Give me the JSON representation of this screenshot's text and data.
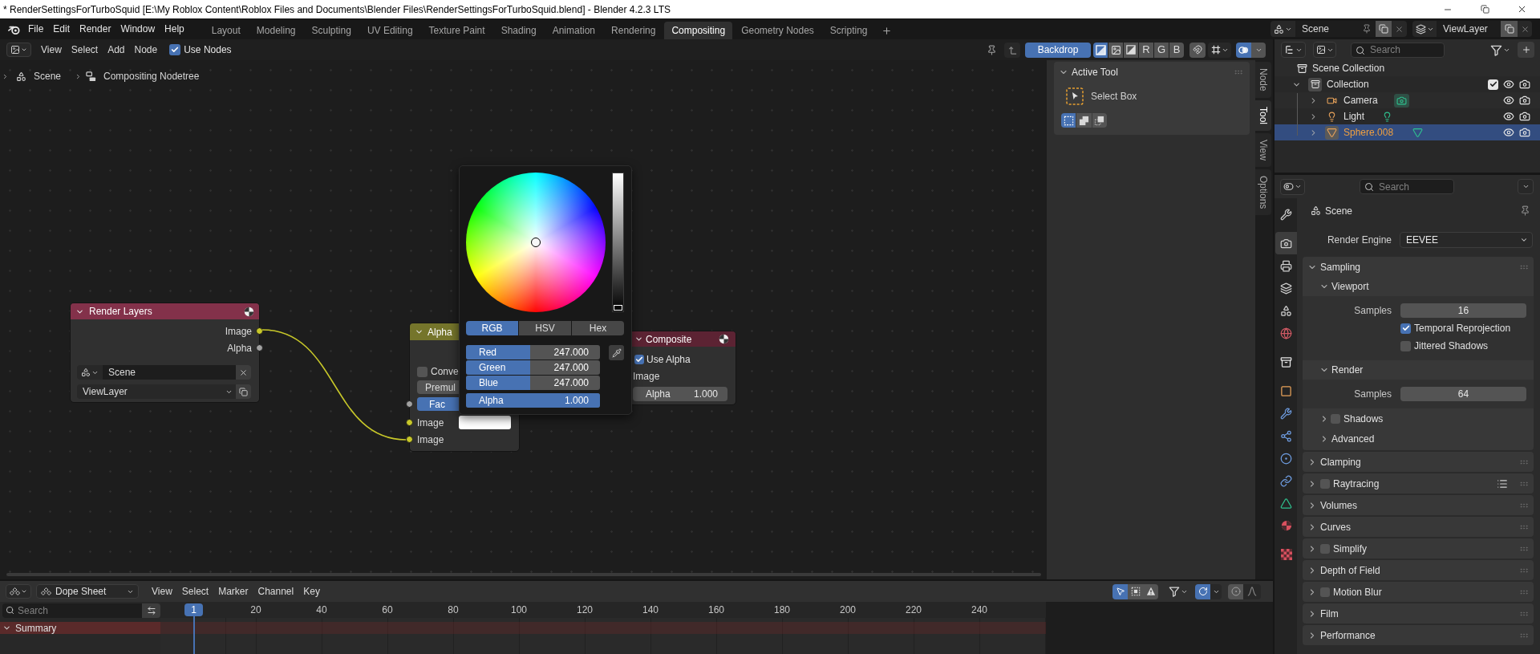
{
  "window": {
    "title": "* RenderSettingsForTurboSquid [E:\\My Roblox Content\\Roblox Files and Documents\\Blender Files\\RenderSettingsForTurboSquid.blend] - Blender 4.2.3 LTS"
  },
  "top_bar": {
    "menus": [
      "File",
      "Edit",
      "Render",
      "Window",
      "Help"
    ],
    "workspaces": [
      {
        "label": "Layout",
        "selected": false
      },
      {
        "label": "Modeling",
        "selected": false
      },
      {
        "label": "Sculpting",
        "selected": false
      },
      {
        "label": "UV Editing",
        "selected": false
      },
      {
        "label": "Texture Paint",
        "selected": false
      },
      {
        "label": "Shading",
        "selected": false
      },
      {
        "label": "Animation",
        "selected": false
      },
      {
        "label": "Rendering",
        "selected": false
      },
      {
        "label": "Compositing",
        "selected": true
      },
      {
        "label": "Geometry Nodes",
        "selected": false
      },
      {
        "label": "Scripting",
        "selected": false
      }
    ],
    "scene": "Scene",
    "view_layer": "ViewLayer"
  },
  "node_editor": {
    "menus": [
      "View",
      "Select",
      "Add",
      "Node"
    ],
    "use_nodes": {
      "label": "Use Nodes",
      "checked": true
    },
    "backdrop": {
      "label": "Backdrop",
      "on": true
    },
    "display_channels": [
      {
        "kind": "color_alpha",
        "selected": true
      },
      {
        "kind": "color",
        "selected": false
      },
      {
        "kind": "alpha",
        "selected": false
      },
      {
        "kind": "letter",
        "label": "R",
        "selected": false
      },
      {
        "kind": "letter",
        "label": "G",
        "selected": false
      },
      {
        "kind": "letter",
        "label": "B",
        "selected": false
      }
    ],
    "snapping": {
      "on": false
    },
    "overlays": {
      "on": true
    },
    "breadcrumb": [
      {
        "kind": "scene",
        "label": "Scene"
      },
      {
        "kind": "node_tree",
        "label": "Compositing Nodetree"
      }
    ],
    "render_layers": {
      "title": "Render Layers",
      "outputs": [
        {
          "label": "Image",
          "kind": "color"
        },
        {
          "label": "Alpha",
          "kind": "value"
        }
      ],
      "scene": "Scene",
      "view_layer": "ViewLayer"
    },
    "alpha_over": {
      "title": "Alpha",
      "convert": {
        "label": "Conve",
        "checked": false
      },
      "premultiply": "Premul",
      "inputs": [
        {
          "kind": "factor",
          "label": "Fac",
          "level": 1
        },
        {
          "kind": "swatch",
          "label": "Image"
        },
        {
          "kind": "linked",
          "label": "Image"
        }
      ]
    },
    "composite": {
      "title": "Composite",
      "use_alpha": {
        "label": "Use Alpha",
        "checked": true
      },
      "input": "Image",
      "alpha": {
        "label": "Alpha",
        "value": "1.000"
      }
    },
    "color_picker": {
      "value_slider": {
        "level": 0
      },
      "modes": [
        {
          "label": "RGB",
          "selected": true
        },
        {
          "label": "HSV",
          "selected": false
        },
        {
          "label": "Hex",
          "selected": false
        }
      ],
      "fields": [
        {
          "label": "Red",
          "value": "247.000",
          "level": 0.48
        },
        {
          "label": "Green",
          "value": "247.000",
          "level": 0.48
        },
        {
          "label": "Blue",
          "value": "247.000",
          "level": 0.48
        },
        {
          "label": "Alpha",
          "value": "1.000",
          "level": 1
        }
      ]
    },
    "sidebar": {
      "tabs": [
        {
          "label": "Node",
          "selected": false
        },
        {
          "label": "Tool",
          "selected": true
        },
        {
          "label": "View",
          "selected": false
        },
        {
          "label": "Options",
          "selected": false
        }
      ],
      "panel": {
        "title": "Active Tool",
        "expanded": true,
        "tool": "Select Box",
        "modes": [
          {
            "kind": "set",
            "selected": true
          },
          {
            "kind": "extend",
            "selected": false
          },
          {
            "kind": "subtract",
            "selected": false
          }
        ]
      }
    }
  },
  "outliner": {
    "search": {
      "placeholder": "Search"
    },
    "tree": [
      {
        "label": "Scene Collection",
        "kind": "scene_collection",
        "selected": false,
        "children": [
          {
            "label": "Collection",
            "kind": "collection",
            "selected": false,
            "expanded": true,
            "checked": true,
            "visible": true,
            "renderable": true,
            "children": [
              {
                "label": "Camera",
                "kind": "camera",
                "selected": false,
                "expanded": false,
                "visible": true,
                "renderable": true
              },
              {
                "label": "Light",
                "kind": "light",
                "selected": false,
                "expanded": false,
                "visible": true,
                "renderable": true
              },
              {
                "label": "Sphere.008",
                "kind": "mesh",
                "selected": true,
                "expanded": false,
                "visible": true,
                "renderable": true
              }
            ]
          }
        ]
      }
    ]
  },
  "properties": {
    "search": {
      "placeholder": "Search"
    },
    "tabs": [
      {
        "kind": "tool",
        "selected": false
      },
      {
        "kind": "render",
        "selected": true
      },
      {
        "kind": "output",
        "selected": false
      },
      {
        "kind": "view_layer",
        "selected": false
      },
      {
        "kind": "scene",
        "selected": false
      },
      {
        "kind": "world",
        "selected": false
      },
      {
        "kind": "collection",
        "selected": false
      },
      {
        "kind": "object",
        "selected": false
      },
      {
        "kind": "modifiers",
        "selected": false
      },
      {
        "kind": "particles",
        "selected": false
      },
      {
        "kind": "physics",
        "selected": false
      },
      {
        "kind": "constraints",
        "selected": false
      },
      {
        "kind": "data",
        "selected": false
      },
      {
        "kind": "material",
        "selected": false
      },
      {
        "kind": "texture",
        "selected": false
      }
    ],
    "context": "Scene",
    "render_engine": {
      "label": "Render Engine",
      "value": "EEVEE"
    },
    "panels": [
      {
        "title": "Sampling",
        "kind": "plain",
        "expanded": true,
        "children": [
          {
            "title": "Viewport",
            "kind": "plain",
            "expanded": true,
            "rows": [
              {
                "kind": "number",
                "label": "Samples",
                "value": "16"
              },
              {
                "kind": "checkbox",
                "label": "Temporal Reprojection",
                "checked": true
              },
              {
                "kind": "checkbox",
                "label": "Jittered Shadows",
                "checked": false
              }
            ]
          },
          {
            "title": "Render",
            "kind": "plain",
            "expanded": true,
            "rows": [
              {
                "kind": "number",
                "label": "Samples",
                "value": "64"
              }
            ]
          },
          {
            "title": "Shadows",
            "kind": "toggle",
            "checked": false,
            "expanded": false
          },
          {
            "title": "Advanced",
            "kind": "plain",
            "expanded": false
          }
        ]
      },
      {
        "title": "Clamping",
        "kind": "plain",
        "expanded": false
      },
      {
        "title": "Raytracing",
        "kind": "toggle",
        "checked": false,
        "expanded": false,
        "presets": true
      },
      {
        "title": "Volumes",
        "kind": "plain",
        "expanded": false
      },
      {
        "title": "Curves",
        "kind": "plain",
        "expanded": false
      },
      {
        "title": "Simplify",
        "kind": "toggle",
        "checked": false,
        "expanded": false
      },
      {
        "title": "Depth of Field",
        "kind": "plain",
        "expanded": false
      },
      {
        "title": "Motion Blur",
        "kind": "toggle",
        "checked": false,
        "expanded": false
      },
      {
        "title": "Film",
        "kind": "plain",
        "expanded": false
      },
      {
        "title": "Performance",
        "kind": "plain",
        "expanded": false
      }
    ]
  },
  "dope_sheet": {
    "mode": "Dope Sheet",
    "menus": [
      "View",
      "Select",
      "Marker",
      "Channel",
      "Key"
    ],
    "only_selected": {
      "on": true
    },
    "snapping": {
      "on": true
    },
    "search": {
      "placeholder": "Search"
    },
    "current_frame": "1",
    "frame_labels": [
      "20",
      "40",
      "60",
      "80",
      "100",
      "120",
      "140",
      "160",
      "180",
      "200",
      "220",
      "240"
    ],
    "channels": [
      {
        "label": "Summary",
        "expanded": true
      }
    ]
  }
}
